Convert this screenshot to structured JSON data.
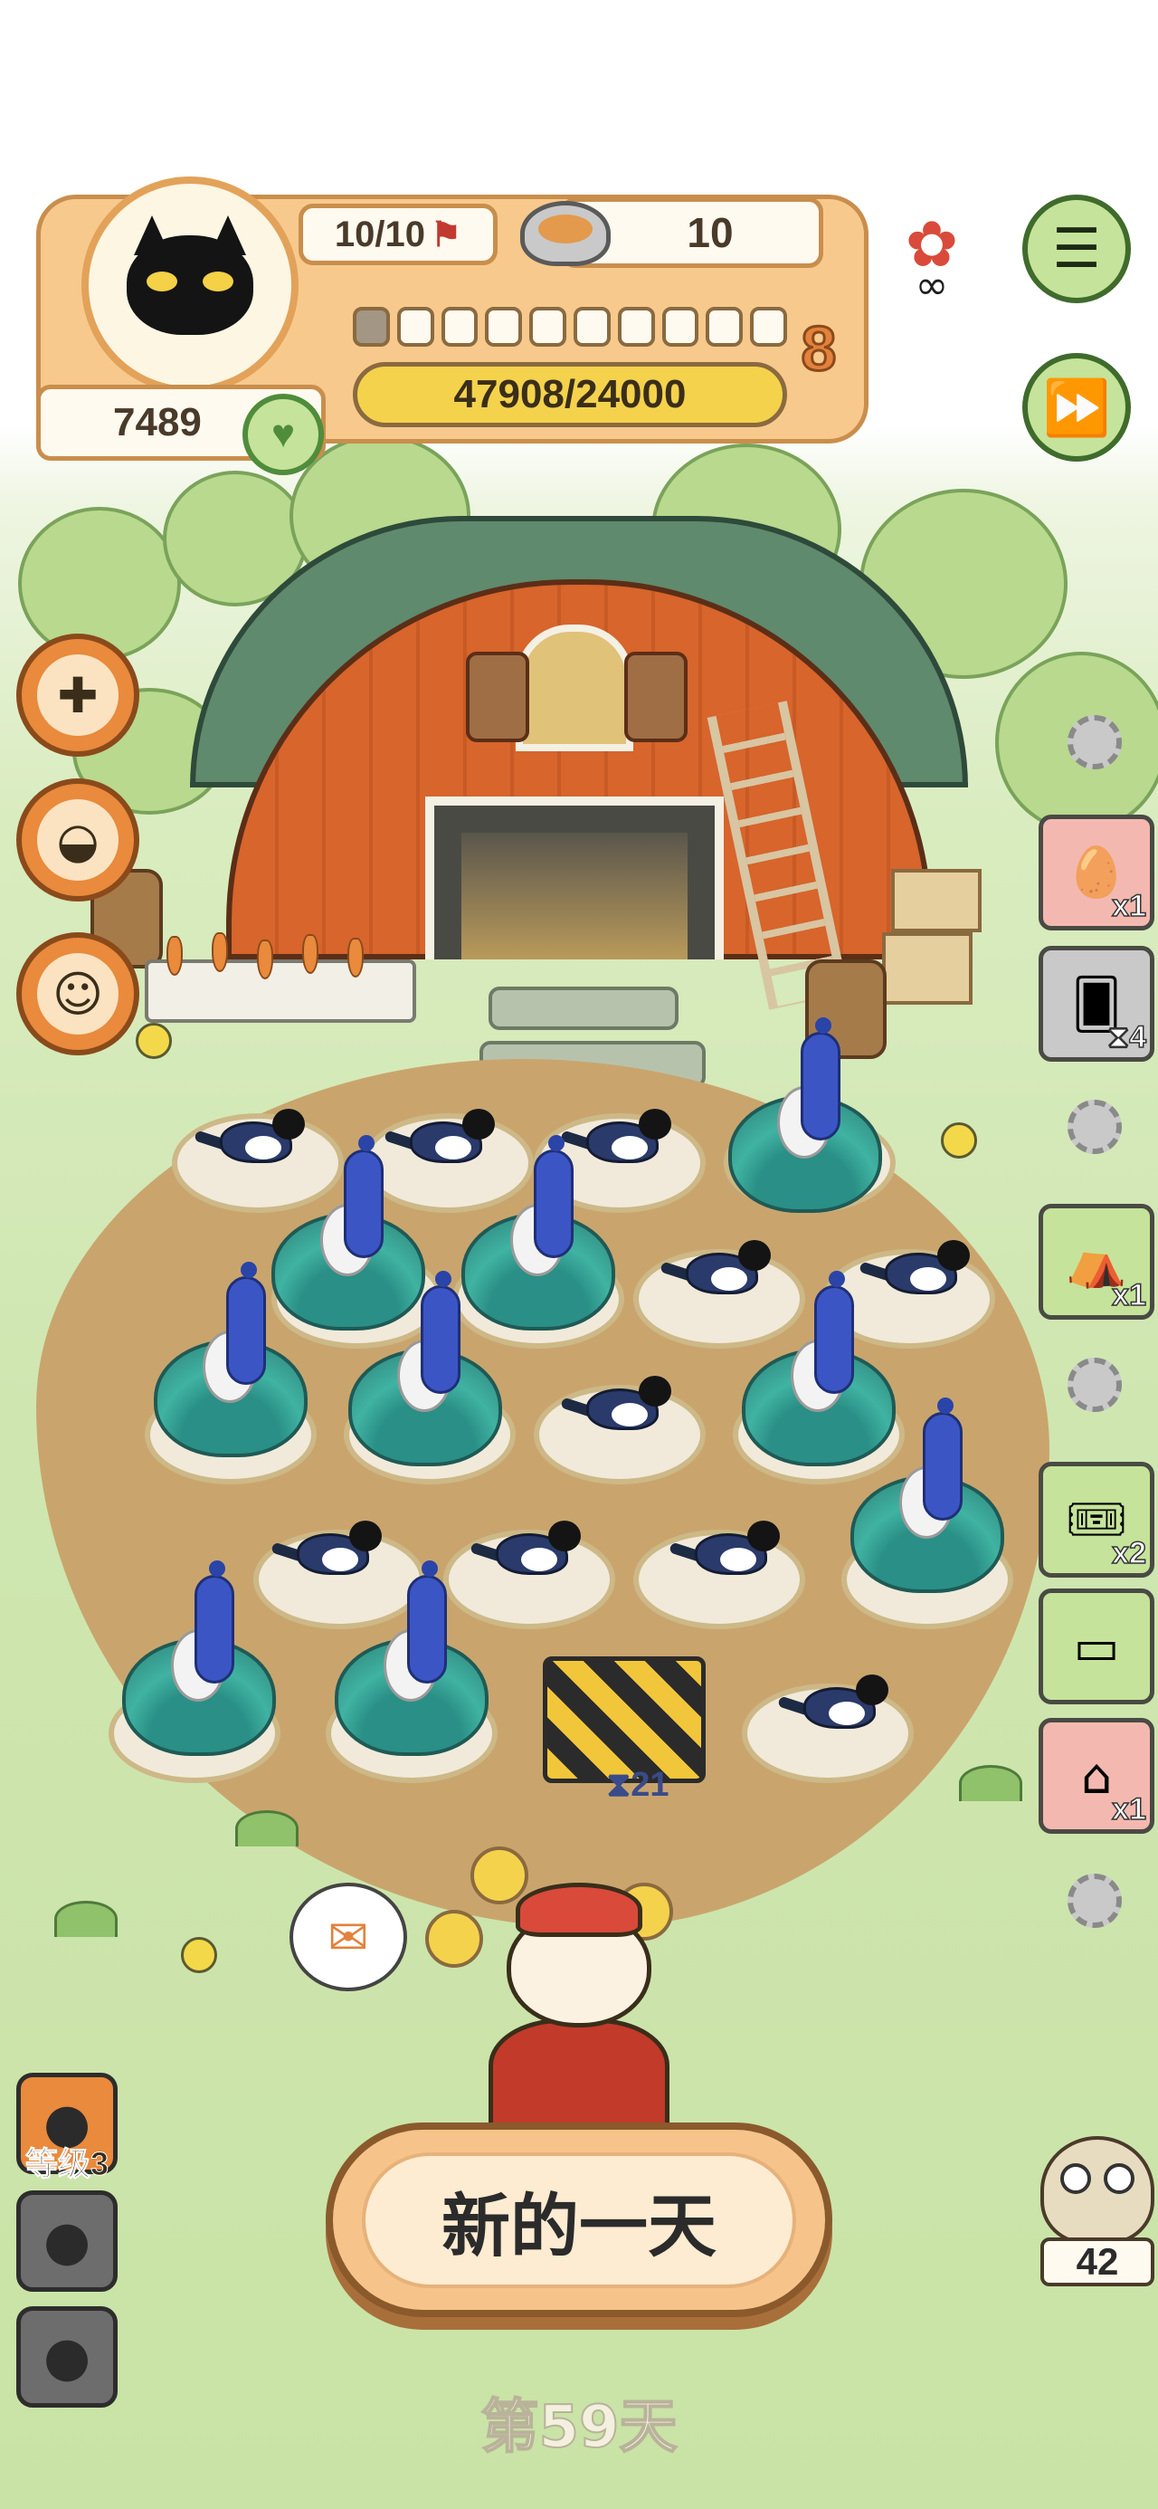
{
  "hud": {
    "energy": "10/10",
    "food": "10",
    "coins": "7489",
    "level": "8",
    "xp": "47908/24000",
    "level_segments_filled": 1,
    "level_segments_total": 10
  },
  "top_right": {
    "menu_icon": "list-icon",
    "fast_forward_icon": "fast-forward-icon",
    "event_icon": "flame-badge-icon"
  },
  "left_buttons": [
    {
      "name": "phone-icon"
    },
    {
      "name": "food-bowl-icon"
    },
    {
      "name": "cat-bowl-icon"
    }
  ],
  "right_cards": [
    {
      "name": "egg-card",
      "icon": "egg-icon",
      "badge": "x1"
    },
    {
      "name": "timer-card",
      "icon": "card-icon",
      "badge": "4"
    },
    {
      "name": "tent-card",
      "icon": "tent-icon",
      "badge": "x1"
    },
    {
      "name": "ticket-card",
      "icon": "ticket-icon",
      "badge": "x2"
    },
    {
      "name": "credit-card",
      "icon": "credit-card-icon",
      "badge": ""
    },
    {
      "name": "cage-card",
      "icon": "cage-icon",
      "badge": "x1"
    }
  ],
  "field": {
    "barrier_timer": "21"
  },
  "bottom": {
    "level_label": "等级3",
    "new_day_button": "新的一天",
    "day_label": "第59天",
    "owl_count": "42"
  },
  "colors": {
    "accent": "#e98a3c",
    "green_button": "#c5e39a",
    "field": "#c9a56d"
  }
}
